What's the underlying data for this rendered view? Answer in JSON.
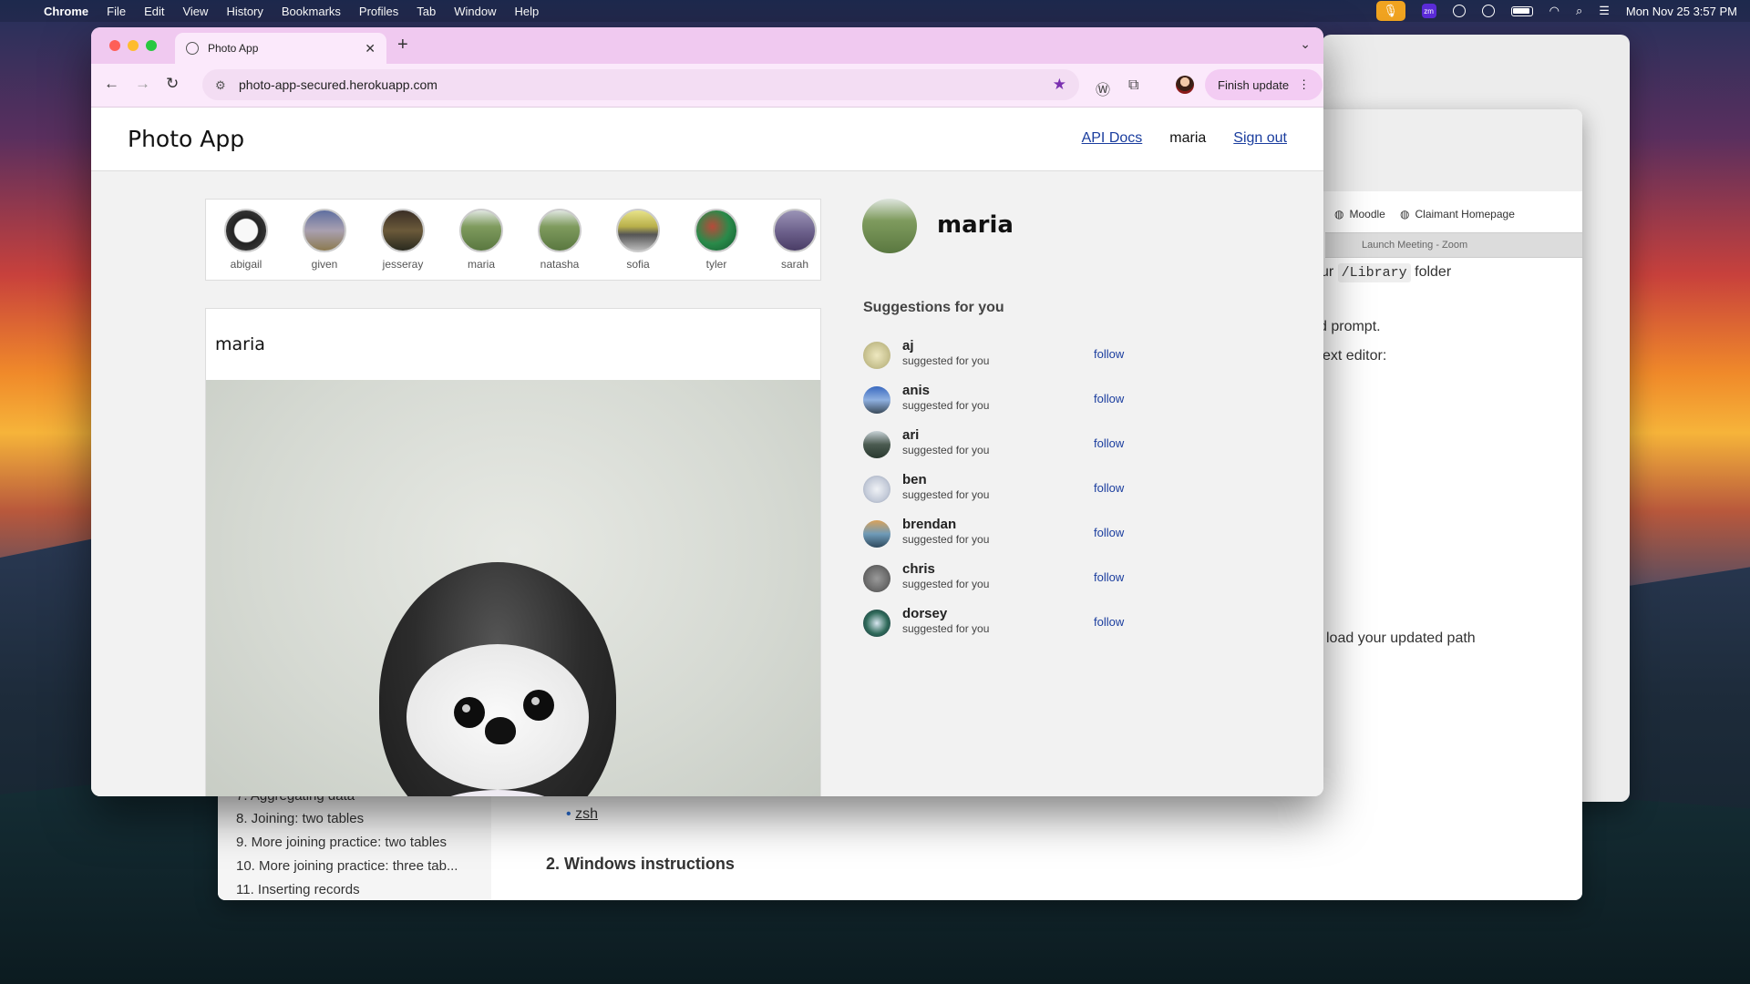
{
  "menubar": {
    "app": "Chrome",
    "items": [
      "File",
      "Edit",
      "View",
      "History",
      "Bookmarks",
      "Profiles",
      "Tab",
      "Window",
      "Help"
    ],
    "clock": "Mon Nov 25  3:57 PM"
  },
  "background_window": {
    "bookmarks": [
      "Moodle",
      "Claimant Homepage"
    ],
    "tab": "Launch Meeting - Zoom",
    "text_lines": [
      {
        "pre": "ur ",
        "code": "/Library",
        "post": " folder"
      },
      {
        "pre": "d prompt.",
        "code": "",
        "post": ""
      },
      {
        "pre": "ext editor:",
        "code": "",
        "post": ""
      },
      {
        "pre": "load your updated path",
        "code": "",
        "post": ""
      }
    ],
    "bullet_link": "zsh",
    "heading": "2. Windows instructions",
    "sidebar_items": [
      "7. Aggregating data",
      "8. Joining: two tables",
      "9. More joining practice: two tables",
      "10. More joining practice: three tab...",
      "11. Inserting records"
    ]
  },
  "browser": {
    "tab_title": "Photo App",
    "url": "photo-app-secured.herokuapp.com",
    "finish_update": "Finish update"
  },
  "page": {
    "brand": "Photo App",
    "nav": {
      "api_docs": "API Docs",
      "user": "maria",
      "signout": "Sign out"
    },
    "stories": [
      {
        "name": "abigail"
      },
      {
        "name": "given"
      },
      {
        "name": "jesseray"
      },
      {
        "name": "maria"
      },
      {
        "name": "natasha"
      },
      {
        "name": "sofia"
      },
      {
        "name": "tyler"
      },
      {
        "name": "sarah"
      }
    ],
    "post": {
      "owner": "maria"
    },
    "profile": {
      "name": "maria"
    },
    "suggestions_title": "Suggestions for you",
    "suggestions": [
      {
        "name": "aj",
        "sub": "suggested for you",
        "action": "follow"
      },
      {
        "name": "anis",
        "sub": "suggested for you",
        "action": "follow"
      },
      {
        "name": "ari",
        "sub": "suggested for you",
        "action": "follow"
      },
      {
        "name": "ben",
        "sub": "suggested for you",
        "action": "follow"
      },
      {
        "name": "brendan",
        "sub": "suggested for you",
        "action": "follow"
      },
      {
        "name": "chris",
        "sub": "suggested for you",
        "action": "follow"
      },
      {
        "name": "dorsey",
        "sub": "suggested for you",
        "action": "follow"
      }
    ]
  },
  "colors": {
    "link": "#1a3d9e",
    "tabbar": "#f0c9f0",
    "omnibar": "#fbe9fb"
  }
}
